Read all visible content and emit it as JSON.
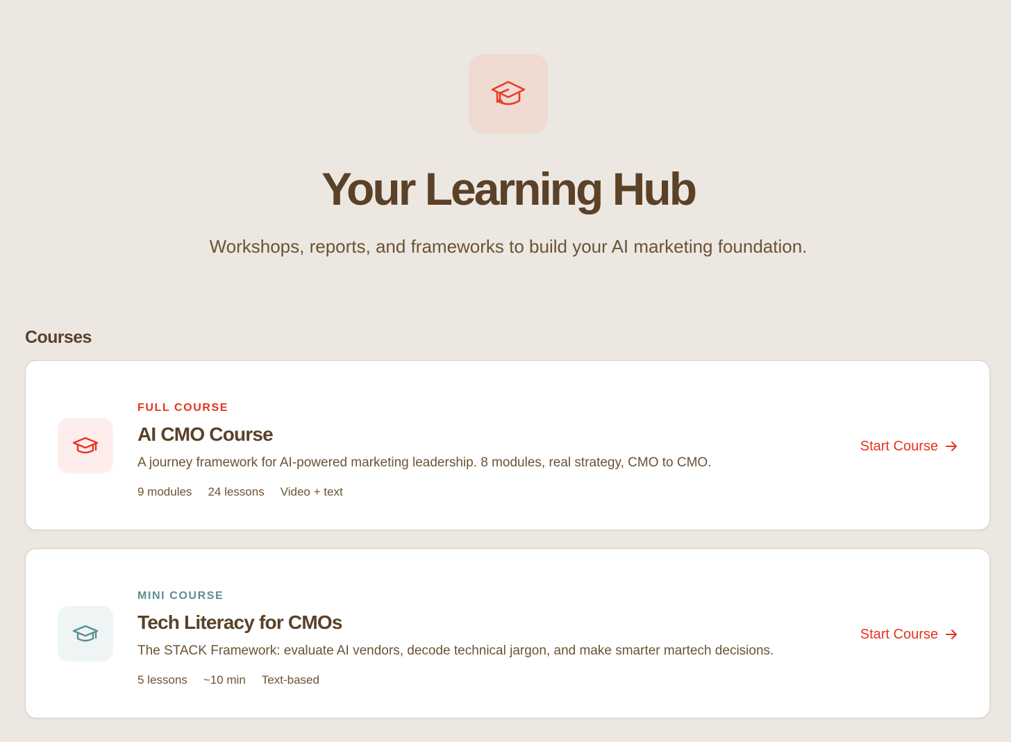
{
  "hero": {
    "icon": "graduation-cap-icon",
    "title": "Your Learning Hub",
    "subtitle": "Workshops, reports, and frameworks to build your AI marketing foundation."
  },
  "section": {
    "heading": "Courses"
  },
  "courses": [
    {
      "icon": "graduation-cap-icon",
      "tag": "FULL COURSE",
      "tag_color": "#e8321e",
      "title": "AI CMO Course",
      "description": "A journey framework for AI-powered marketing leadership. 8 modules, real strategy, CMO to CMO.",
      "meta": [
        "9 modules",
        "24 lessons",
        "Video + text"
      ],
      "cta": "Start Course"
    },
    {
      "icon": "graduation-cap-icon",
      "tag": "MINI COURSE",
      "tag_color": "#5b8e92",
      "title": "Tech Literacy for CMOs",
      "description": "The STACK Framework: evaluate AI vendors, decode technical jargon, and make smarter martech decisions.",
      "meta": [
        "5 lessons",
        "~10 min",
        "Text-based"
      ],
      "cta": "Start Course"
    }
  ],
  "colors": {
    "background": "#ece8e1",
    "text": "#5a4128",
    "accent": "#e8321e",
    "teal": "#5b8e92"
  }
}
